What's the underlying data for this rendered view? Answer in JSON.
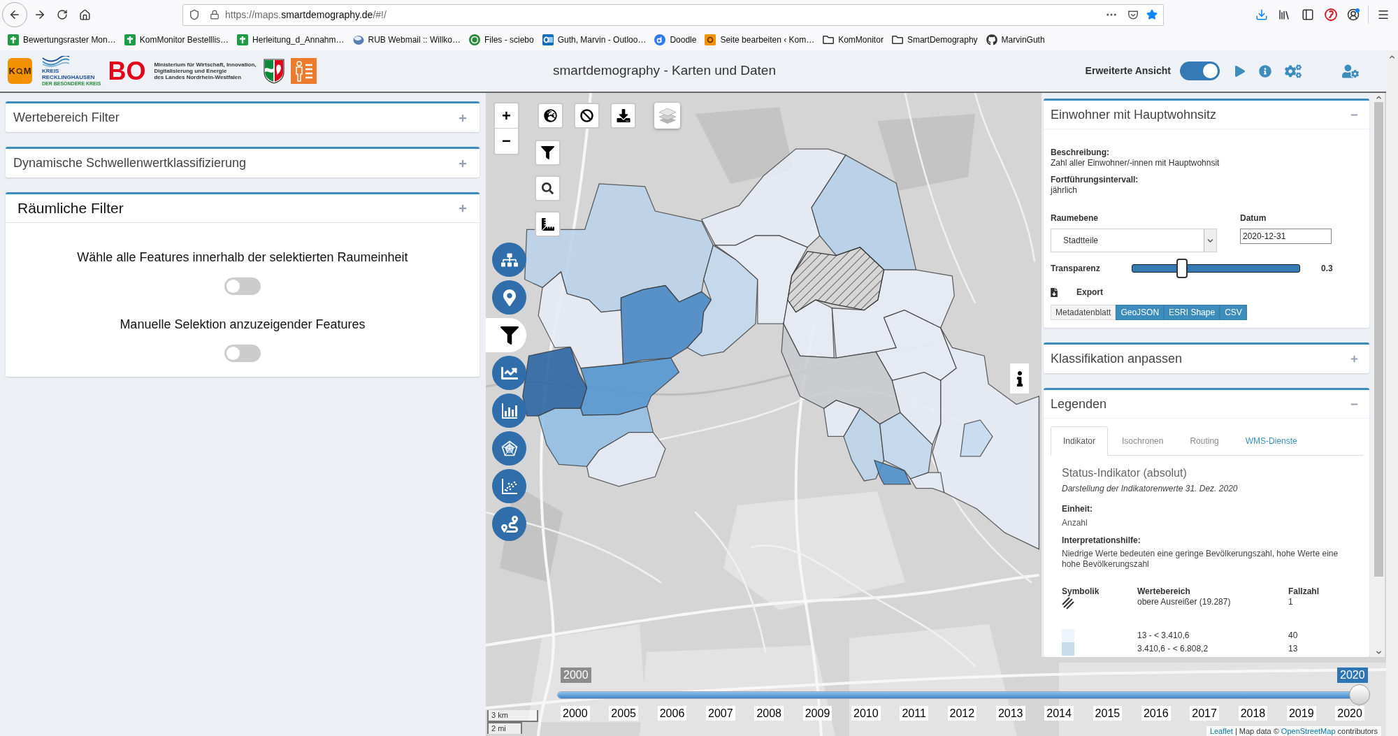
{
  "browser": {
    "url": {
      "prefix": "https://maps.",
      "domain": "smartdemography.de",
      "path": "/#!/"
    },
    "bookmarks": [
      "Bewertungsraster Mon…",
      "KomMonitor Bestelllis…",
      "Herleitung_d_Annahm…",
      "RUB Webmail :: Willko…",
      "Files - sciebo",
      "Guth, Marvin - Outloo…",
      "Doodle",
      "Seite bearbeiten ‹ Kom…",
      "KomMonitor",
      "SmartDemography",
      "MarvinGuth"
    ]
  },
  "header": {
    "logos": {
      "km": [
        "K",
        "M"
      ],
      "kreis": {
        "name": [
          "KREIS",
          "RECKLINGHAUSEN"
        ],
        "tagline": "DER BESONDERE KREIS"
      },
      "bo": "BO",
      "ministry": [
        "Ministerium für Wirtschaft, Innovation,",
        "Digitalisierung und Energie",
        "des Landes Nordrhein-Westfalen"
      ]
    },
    "title": "smartdemography - Karten und Daten",
    "extended_view": {
      "label": "Erweiterte Ansicht",
      "on": true
    }
  },
  "left_panel": {
    "cards": [
      {
        "title": "Wertebereich Filter",
        "expanded": false
      },
      {
        "title": "Dynamische Schwellenwertklassifizierung",
        "expanded": false
      },
      {
        "title": "Räumliche Filter",
        "expanded": true,
        "options": [
          {
            "label": "Wähle alle Features innerhalb der selektierten Raumeinheit",
            "on": false
          },
          {
            "label": "Manuelle Selektion anzuzeigender Features",
            "on": false
          }
        ]
      }
    ]
  },
  "map": {
    "zoom": {
      "in": "+",
      "out": "−"
    },
    "sidebar": [
      {
        "selected": false
      },
      {
        "selected": false
      },
      {
        "selected": true
      },
      {
        "selected": false
      },
      {
        "selected": false
      },
      {
        "selected": false
      },
      {
        "selected": false
      },
      {
        "selected": false
      }
    ],
    "timeline": {
      "start_badge": "2000",
      "end_badge": "2020",
      "level": 1,
      "years": [
        "2000",
        "2005",
        "2006",
        "2007",
        "2008",
        "2009",
        "2010",
        "2011",
        "2012",
        "2013",
        "2014",
        "2015",
        "2016",
        "2017",
        "2018",
        "2019",
        "2020"
      ]
    },
    "scale": [
      "3 km",
      "2 mi"
    ],
    "attribution": [
      {
        "kind": "link",
        "text": "Leaflet"
      },
      {
        "kind": "text",
        "text": "| Map data ©"
      },
      {
        "kind": "link",
        "text": "OpenStreetMap"
      },
      {
        "kind": "text",
        "text": "contributors"
      }
    ]
  },
  "right_panel": {
    "indicator_card": {
      "title": "Einwohner mit Hauptwohnsitz",
      "expanded": true,
      "fields": [
        {
          "label": "Beschreibung:",
          "value": "Zahl aller Einwohner/-innen mit Hauptwohnsit"
        },
        {
          "label": "Fortführungsintervall:",
          "value": "jährlich"
        }
      ],
      "spatial_level": {
        "label": "Raumebene",
        "value": "Stadtteile"
      },
      "date": {
        "label": "Datum",
        "value": "2020-12-31"
      },
      "transparency": {
        "label": "Transparenz",
        "level": 0.3,
        "reading": "0.3"
      },
      "export": {
        "label": "Export",
        "buttons": [
          {
            "label": "Metadatenblatt",
            "kind": "default"
          },
          {
            "label": "GeoJSON",
            "kind": "primary"
          },
          {
            "label": "ESRI Shape",
            "kind": "primary"
          },
          {
            "label": "CSV",
            "kind": "primary"
          }
        ]
      }
    },
    "classification_card": {
      "title": "Klassifikation anpassen",
      "expanded": false
    },
    "legend_card": {
      "title": "Legenden",
      "expanded": true,
      "tabs": [
        {
          "label": "Indikator",
          "selected": true,
          "disabled": false
        },
        {
          "label": "Isochronen",
          "selected": false,
          "disabled": true
        },
        {
          "label": "Routing",
          "selected": false,
          "disabled": true
        },
        {
          "label": "WMS-Dienste",
          "selected": false,
          "disabled": false
        }
      ],
      "heading": "Status-Indikator (absolut)",
      "subheading": "Darstellung der Indikatorenwerte 31. Dez. 2020",
      "unit": {
        "label": "Einheit:",
        "value": "Anzahl"
      },
      "hint": {
        "label": "Interpretationshilfe:",
        "value": "Niedrige Werte bedeuten eine geringe Bevölkerungszahl, hohe Werte eine hohe Bevölkerungszahl"
      },
      "table": {
        "columns": [
          "Symbolik",
          "Wertebereich",
          "Fallzahl"
        ],
        "rows": [
          {
            "kind": "hatch",
            "range": "obere Ausreißer (19.287)",
            "count": "1"
          },
          {
            "kind": "swatch",
            "color": "#eef4fb",
            "range": "13 - < 3.410,6",
            "count": "40"
          },
          {
            "kind": "swatch",
            "color": "#c8dcee",
            "range": "3.410,6 - < 6.808,2",
            "count": "13"
          }
        ]
      }
    }
  }
}
